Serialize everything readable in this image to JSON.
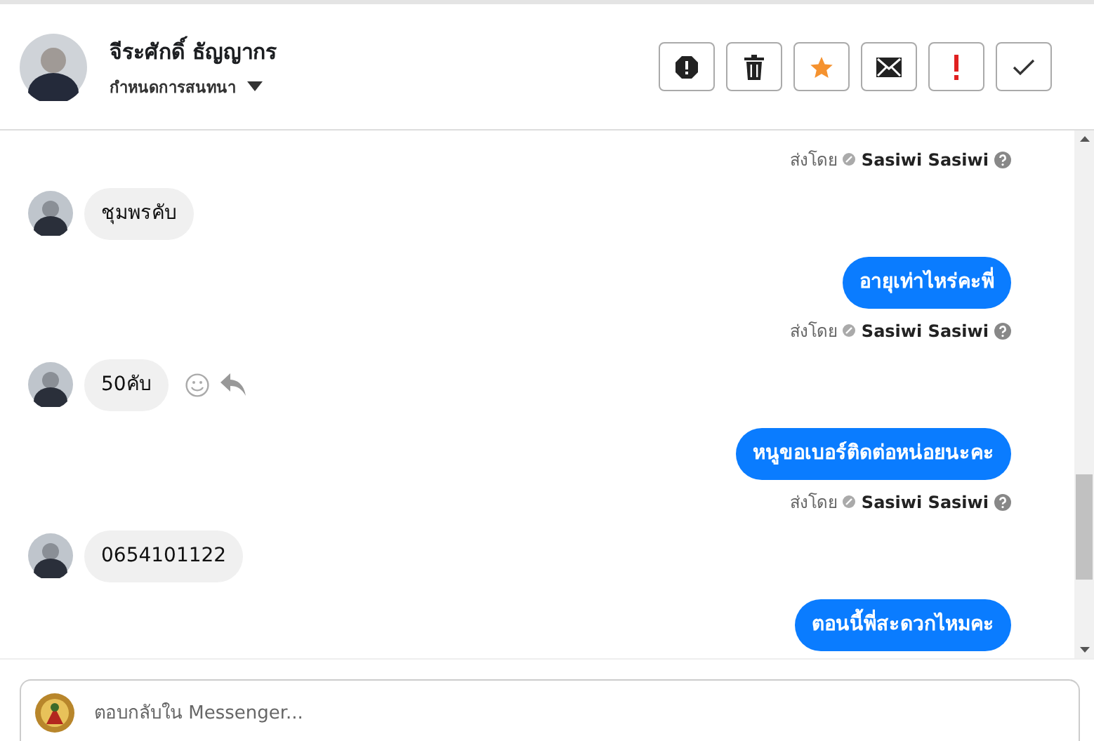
{
  "contact": {
    "name": "จีระศักดิ์ ธัญญากร",
    "subtitle": "กำหนดการสนทนา"
  },
  "toolbar": [
    {
      "kind": "spam"
    },
    {
      "kind": "delete"
    },
    {
      "kind": "star"
    },
    {
      "kind": "unread"
    },
    {
      "kind": "important"
    },
    {
      "kind": "done"
    }
  ],
  "messages": [
    {
      "kind": "sent_by",
      "label": "ส่งโดย",
      "name": "Sasiwi Sasiwi"
    },
    {
      "kind": "received",
      "text": "ชุมพรคับ",
      "show_actions": false
    },
    {
      "kind": "sent",
      "text": "อายุเท่าไหร่คะพี่"
    },
    {
      "kind": "sent_by",
      "label": "ส่งโดย",
      "name": "Sasiwi Sasiwi"
    },
    {
      "kind": "received",
      "text": "50คับ",
      "show_actions": true
    },
    {
      "kind": "sent",
      "text": "หนูขอเบอร์ติดต่อหน่อยนะคะ"
    },
    {
      "kind": "sent_by",
      "label": "ส่งโดย",
      "name": "Sasiwi Sasiwi"
    },
    {
      "kind": "received",
      "text": "0654101122",
      "show_actions": false
    },
    {
      "kind": "sent",
      "text": "ตอนนี้พี่สะดวกไหมคะ"
    }
  ],
  "composer": {
    "placeholder": "ตอบกลับใน Messenger..."
  }
}
